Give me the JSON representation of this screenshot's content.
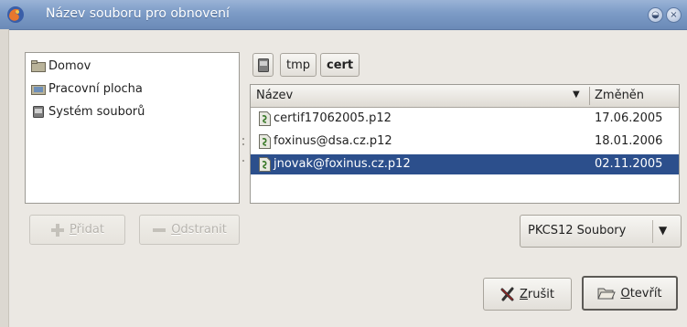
{
  "window": {
    "title": "Název souboru pro obnovení",
    "minimize_glyph": "◒",
    "close_glyph": "×"
  },
  "places": [
    {
      "label": "Domov",
      "icon": "home-folder-icon"
    },
    {
      "label": "Pracovní plocha",
      "icon": "desktop-icon"
    },
    {
      "label": "Systém souborů",
      "icon": "drive-icon"
    }
  ],
  "path_bar": {
    "icon": "drive-icon",
    "segments": [
      "tmp",
      "cert"
    ]
  },
  "file_list": {
    "columns": {
      "name": "Název",
      "modified": "Změněn"
    },
    "sort_glyph": "▼",
    "rows": [
      {
        "name": "certif17062005.p12",
        "modified": "17.06.2005",
        "selected": false
      },
      {
        "name": "foxinus@dsa.cz.p12",
        "modified": "18.01.2006",
        "selected": false
      },
      {
        "name": "jnovak@foxinus.cz.p12",
        "modified": "02.11.2005",
        "selected": true
      }
    ]
  },
  "buttons": {
    "add": {
      "mnemonic": "P",
      "rest": "řidat"
    },
    "remove": {
      "mnemonic": "O",
      "rest": "dstranit"
    },
    "cancel": {
      "mnemonic": "Z",
      "rest": "rušit"
    },
    "open": {
      "mnemonic": "O",
      "rest": "tevřít"
    }
  },
  "filter": {
    "selected": "PKCS12 Soubory",
    "arrow": "▼"
  },
  "colors": {
    "titlebar": "#7c9bc6",
    "selection": "#2c4f8c"
  }
}
